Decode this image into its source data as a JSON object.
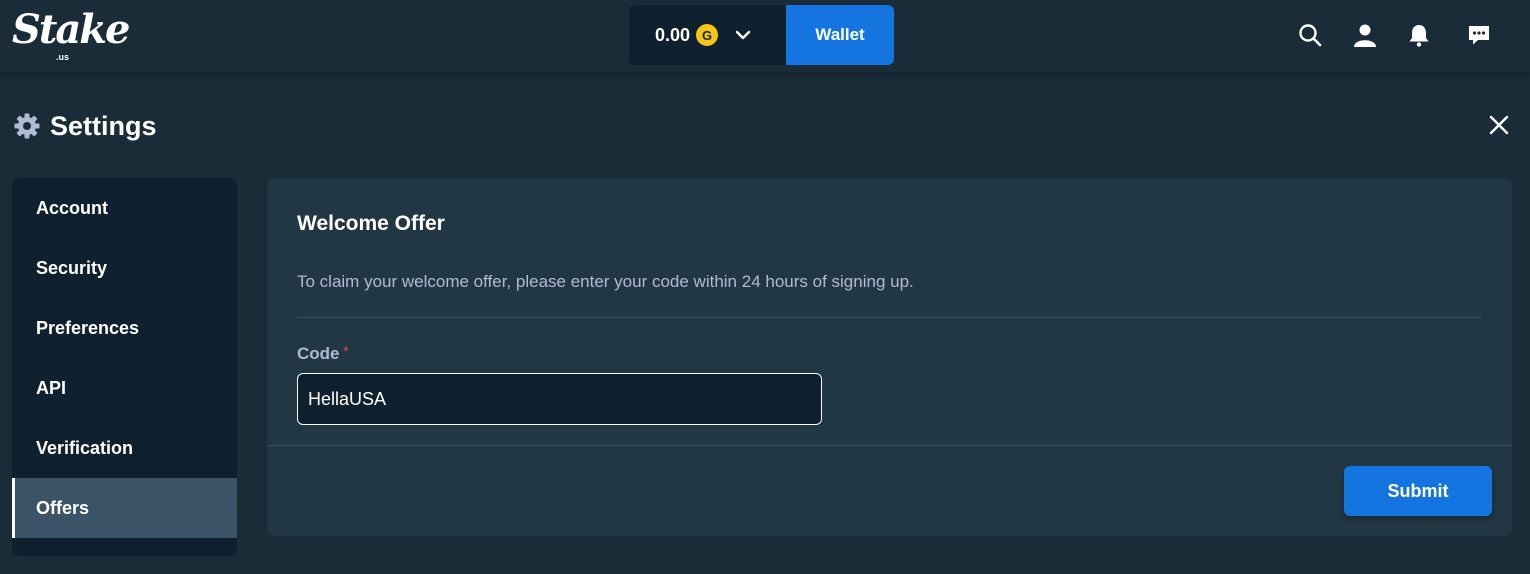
{
  "brand": {
    "name": "Stake",
    "suffix": ".us"
  },
  "topbar": {
    "balance": "0.00",
    "coin_symbol": "G",
    "wallet_label": "Wallet",
    "icons": [
      "chevron-down-icon",
      "search-icon",
      "user-icon",
      "bell-icon",
      "chat-icon"
    ]
  },
  "settings": {
    "title": "Settings",
    "icon": "gear-icon"
  },
  "sidebar": {
    "items": [
      {
        "label": "Account"
      },
      {
        "label": "Security"
      },
      {
        "label": "Preferences"
      },
      {
        "label": "API"
      },
      {
        "label": "Verification"
      },
      {
        "label": "Offers",
        "active": true
      }
    ]
  },
  "panel": {
    "title": "Welcome Offer",
    "description": "To claim your welcome offer, please enter your code within 24 hours of signing up.",
    "code_label": "Code",
    "required_mark": "*",
    "code_value": "HellaUSA",
    "submit_label": "Submit"
  },
  "colors": {
    "background": "#1a2c38",
    "sidebar": "#0f212e",
    "panel": "#213743",
    "accent_blue": "#1475e1",
    "coin_gold": "#f5c518",
    "muted_text": "#b1bad3"
  }
}
